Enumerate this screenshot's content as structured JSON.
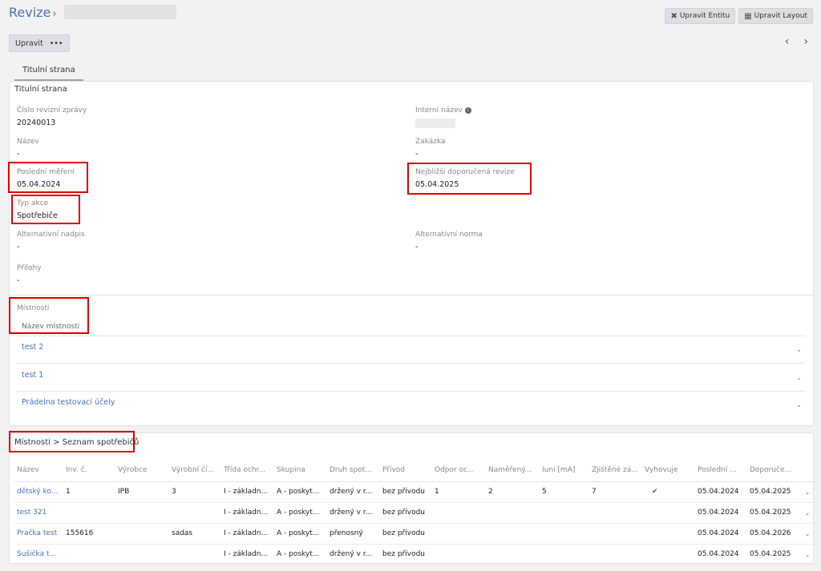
{
  "header": {
    "title": "Revize",
    "separator": "›",
    "buttons": [
      {
        "icon": "✖",
        "icon_name": "tools-icon",
        "label": "Upravit Entitu"
      },
      {
        "icon": "▦",
        "icon_name": "layout-icon",
        "label": "Upravit Layout"
      }
    ]
  },
  "toolbar": {
    "edit_label": "Upravit",
    "more_label": "•••",
    "prev": "‹",
    "next": "›"
  },
  "tabs": [
    {
      "label": "Titulní strana"
    }
  ],
  "section1": {
    "title": "Titulní strana",
    "fields": {
      "report_number": {
        "label": "Číslo revizní zprávy",
        "value": "20240013"
      },
      "internal_name": {
        "label": "Interní název",
        "info": "i"
      },
      "name": {
        "label": "Název",
        "value": "-"
      },
      "order": {
        "label": "Zakázka",
        "value": "-"
      },
      "last_measurement": {
        "label": "Poslední měření",
        "value": "05.04.2024"
      },
      "next_revision": {
        "label": "Nejbližší doporučená revize",
        "value": "05.04.2025"
      },
      "action_type": {
        "label": "Typ akce",
        "value": "Spotřebiče"
      },
      "alt_heading": {
        "label": "Alternativní nadpis",
        "value": "-"
      },
      "alt_norm": {
        "label": "Alternativní norma",
        "value": "-"
      },
      "attachments": {
        "label": "Přílohy",
        "value": "-"
      }
    },
    "rooms": {
      "label": "Místnosti",
      "column": "Název místnosti",
      "items": [
        {
          "name": "test 2"
        },
        {
          "name": "test 1"
        },
        {
          "name": "Prádelna testovací účely"
        }
      ],
      "chevron": "⌄"
    }
  },
  "section2": {
    "title": "Místnosti > Seznam spotřebičů",
    "columns": [
      "Název",
      "Inv. č.",
      "Výrobce",
      "Výrobní čí...",
      "Třída ochr...",
      "Skupina",
      "Druh spot...",
      "Přívod",
      "Odpor oc...",
      "Naměřený...",
      "Iuni [mA]",
      "Zjištěné zá...",
      "Vyhovuje",
      "Poslední ...",
      "Doporuče..."
    ],
    "rows": [
      [
        "dětský ko...",
        "1",
        "IPB",
        "3",
        "I - základn...",
        "A - poskyt...",
        "držený v r...",
        "bez přívodu",
        "1",
        "2",
        "5",
        "7",
        "✔",
        "05.04.2024",
        "05.04.2025"
      ],
      [
        "test 321",
        "",
        "",
        "",
        "I - základn...",
        "A - poskyt...",
        "držený v r...",
        "bez přívodu",
        "",
        "",
        "",
        "",
        "",
        "05.04.2024",
        "05.04.2025"
      ],
      [
        "Pračka test",
        "155616",
        "",
        "sadas",
        "I - základn...",
        "A - poskyt...",
        "přenosný",
        "bez přívodu",
        "",
        "",
        "",
        "",
        "",
        "05.04.2024",
        "05.04.2026"
      ],
      [
        "Sušička t...",
        "",
        "",
        "",
        "I - základn...",
        "A - poskyt...",
        "držený v r...",
        "bez přívodu",
        "",
        "",
        "",
        "",
        "",
        "05.04.2024",
        "05.04.2025"
      ]
    ],
    "chevron": "⌄"
  }
}
